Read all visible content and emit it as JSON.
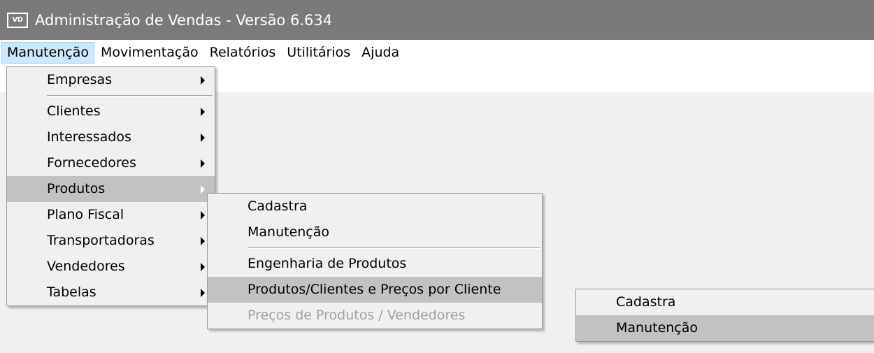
{
  "window": {
    "icon_text": "VD",
    "title": "Administração de Vendas - Versão 6.634"
  },
  "menubar": {
    "items": [
      "Manutenção",
      "Movimentação",
      "Relatórios",
      "Utilitários",
      "Ajuda"
    ]
  },
  "menu_manutencao": {
    "items": [
      {
        "label": "Empresas"
      },
      {
        "label": "Clientes"
      },
      {
        "label": "Interessados"
      },
      {
        "label": "Fornecedores"
      },
      {
        "label": "Produtos"
      },
      {
        "label": "Plano Fiscal"
      },
      {
        "label": "Transportadoras"
      },
      {
        "label": "Vendedores"
      },
      {
        "label": "Tabelas"
      }
    ]
  },
  "menu_produtos": {
    "items": [
      {
        "label": "Cadastra"
      },
      {
        "label": "Manutenção"
      },
      {
        "label": "Engenharia de Produtos"
      },
      {
        "label": "Produtos/Clientes e Preços por Cliente"
      },
      {
        "label": "Preços de Produtos / Vendedores"
      }
    ]
  },
  "menu_precos_cliente": {
    "items": [
      {
        "label": "Cadastra"
      },
      {
        "label": "Manutenção"
      }
    ]
  },
  "icons": {
    "submenu_arrow": "triangle-right-icon",
    "app_icon": "vd-app-icon"
  },
  "colors": {
    "titlebar": "#7a7a7a",
    "menu_highlight": "#c2c2c2",
    "menubar_active": "#cce8ff",
    "disabled_text": "#a0a0a0"
  }
}
